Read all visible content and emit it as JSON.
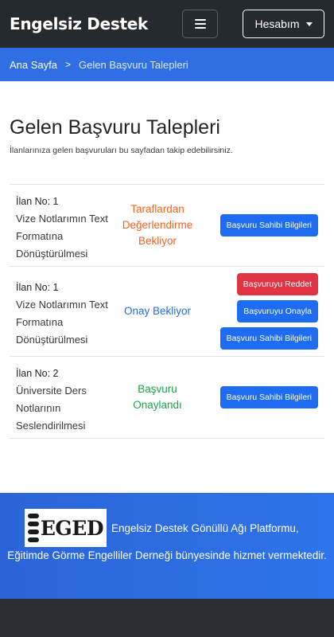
{
  "navbar": {
    "brand": "Engelsiz Destek",
    "menu_icon": "hamburger-menu-icon",
    "account_label": "Hesabım"
  },
  "breadcrumb": {
    "home": "Ana Sayfa",
    "separator": ">",
    "current": "Gelen Başvuru Talepleri"
  },
  "page": {
    "title": "Gelen Başvuru Talepleri",
    "subtitle": "İlanlarınıza gelen başvuruları bu sayfadan takip edebilirsiniz."
  },
  "applications": [
    {
      "ilan_no": "İlan No: 1",
      "title": "Vize Notlarımın Text Formatına Dönüştürülmesi",
      "status": "Taraflardan Değerlendirme Bekliyor",
      "status_color": "#f0641e",
      "buttons": [
        "Başvuru Sahibi Bilgileri"
      ]
    },
    {
      "ilan_no": "İlan No: 1",
      "title": "Vize Notlarımın Text Formatına Dönüştürülmesi",
      "status": "Onay Bekliyor",
      "status_color": "#1f6de3",
      "buttons": [
        "Başvuruyu Reddet",
        "Başvuruyu Onayla",
        "Başvuru Sahibi Bilgileri"
      ]
    },
    {
      "ilan_no": "İlan No: 2",
      "title": "Üniversite Ders Notlarının Seslendirilmesi",
      "status": "Başvuru Onaylandı",
      "status_color": "#1aa34a",
      "buttons": [
        "Başvuru Sahibi Bilgileri"
      ]
    }
  ],
  "footer": {
    "logo_text": "EGED",
    "line1": "Engelsiz Destek Gönüllü Ağı Platformu,",
    "line2": "Eğitimde Görme Engelliler Derneği bünyesinde hizmet vermektedir."
  },
  "colors": {
    "navbar_bg": "#252a2f",
    "accent": "#2f6fe3",
    "primary_button": "#1e6cf2",
    "danger_button": "#e03444"
  }
}
